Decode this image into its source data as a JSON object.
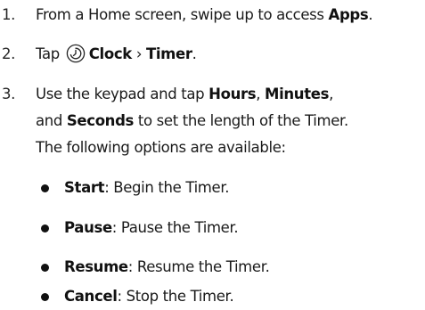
{
  "steps": [
    {
      "number": "1.",
      "text_before": "From a Home screen, swipe up to access ",
      "bold": "Apps",
      "text_after": "."
    },
    {
      "number": "2.",
      "text_before": "Tap",
      "icon": "clock-app-icon",
      "bold_app": "Clock",
      "separator": "›",
      "bold_item": "Timer",
      "text_after": "."
    },
    {
      "number": "3.",
      "line1_before": "Use the keypad and tap ",
      "bold_hours": "Hours",
      "comma": ", ",
      "bold_minutes": "Minutes",
      "comma2": ",",
      "line2_before": "and ",
      "bold_seconds": "Seconds",
      "line2_after": " to set the length of the Timer.",
      "line3": "The following options are available:"
    }
  ],
  "options": [
    {
      "term": "Start",
      "desc": ": Begin the Timer."
    },
    {
      "term": "Pause",
      "desc": ": Pause the Timer."
    },
    {
      "term": "Resume",
      "desc": ": Resume the Timer."
    },
    {
      "term": "Cancel",
      "desc": ": Stop the Timer."
    }
  ]
}
